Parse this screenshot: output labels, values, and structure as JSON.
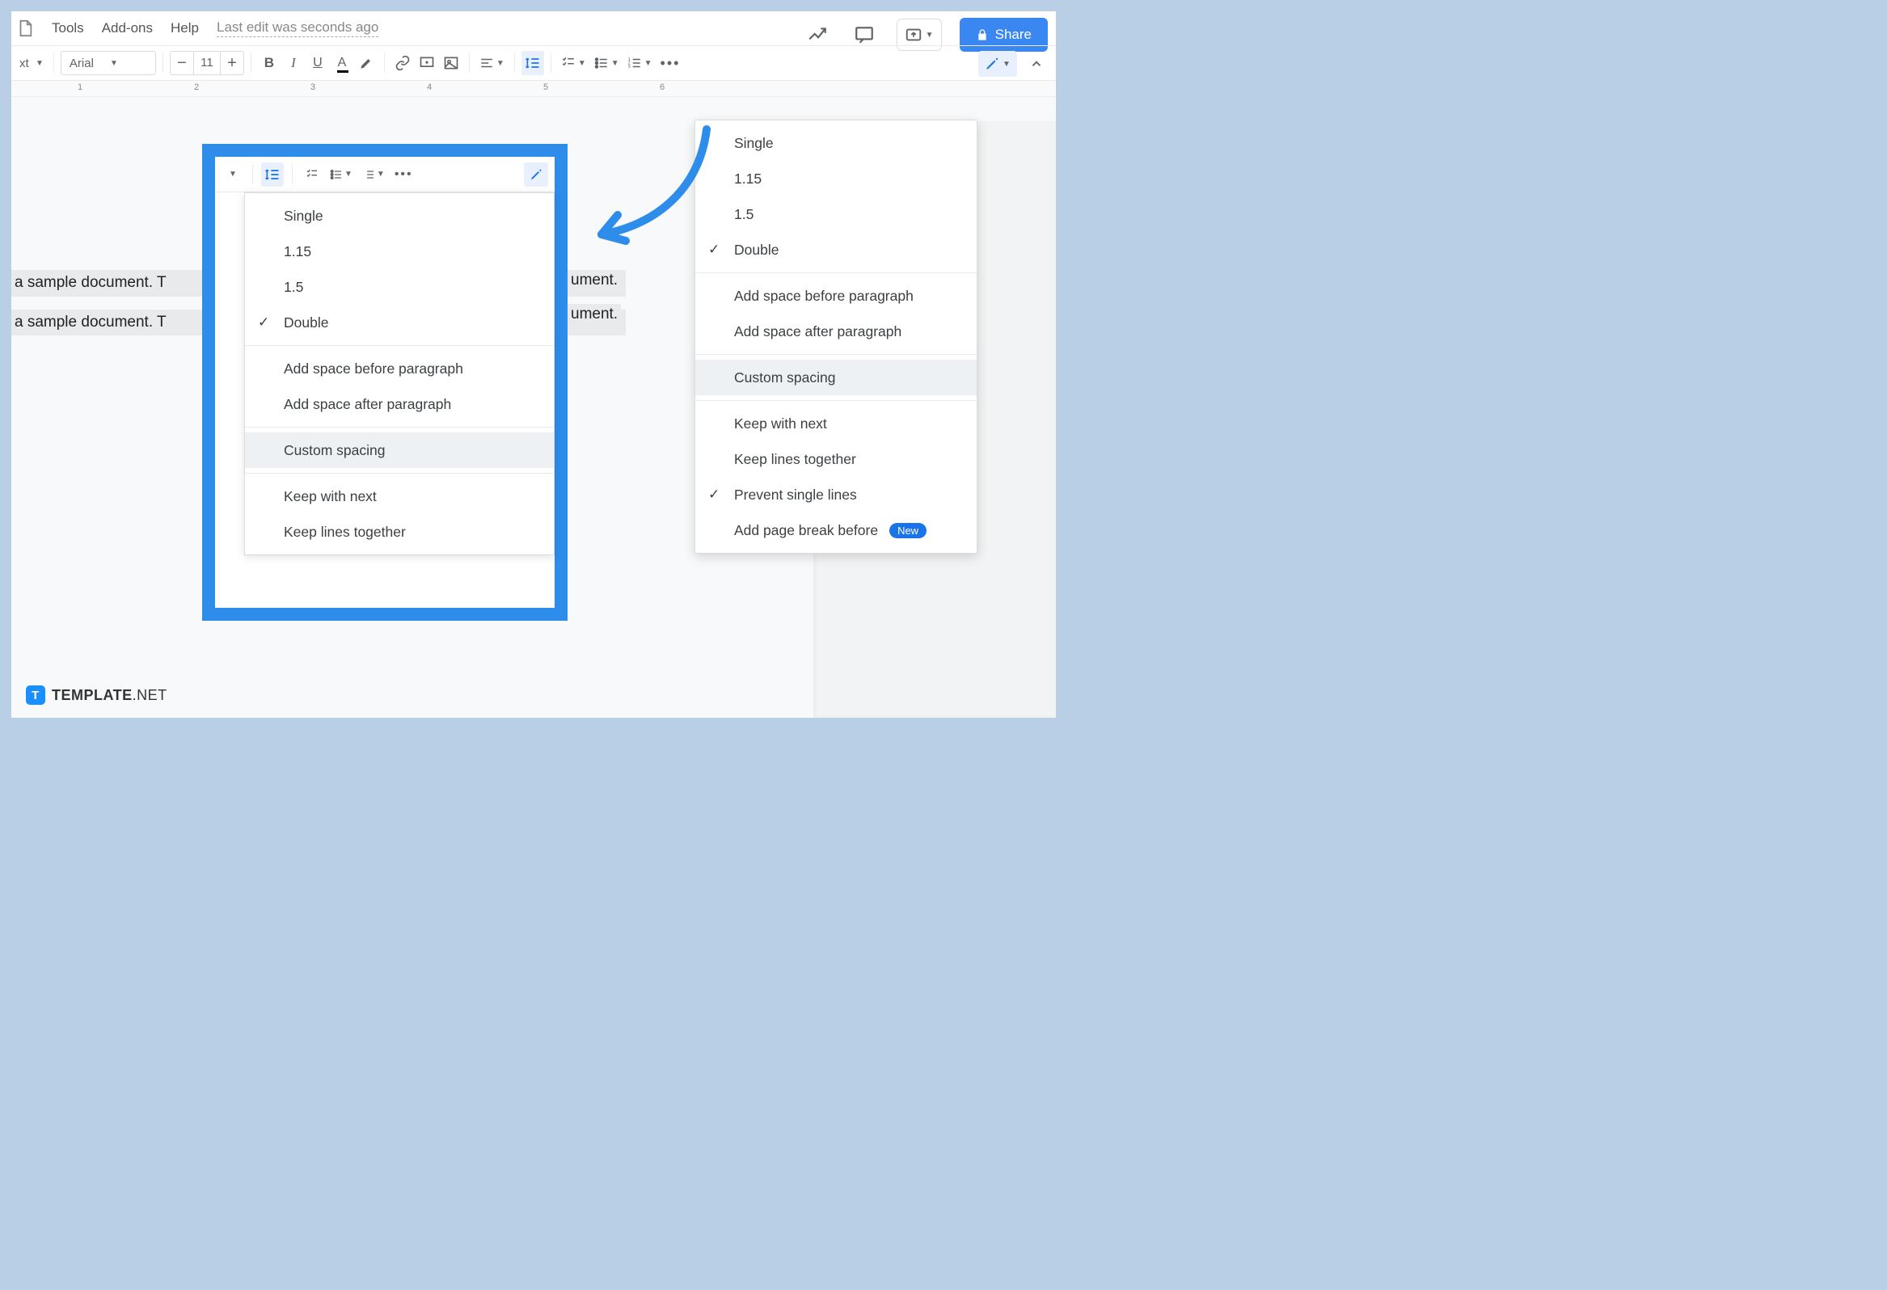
{
  "menu": {
    "tools": "Tools",
    "addons": "Add-ons",
    "help": "Help",
    "edit_status": "Last edit was seconds ago"
  },
  "share_label": "Share",
  "toolbar": {
    "style_label": "xt",
    "font": "Arial",
    "font_size": "11"
  },
  "doc": {
    "line1": "a sample document. T",
    "line2": "a sample document. T",
    "right1": "ument.",
    "right2": "ument."
  },
  "spacing_menu": {
    "single": "Single",
    "v115": "1.15",
    "v15": "1.5",
    "double": "Double",
    "before": "Add space before paragraph",
    "after": "Add space after paragraph",
    "custom": "Custom spacing",
    "keep_next": "Keep with next",
    "keep_lines": "Keep lines together",
    "prevent": "Prevent single lines",
    "page_break": "Add page break before",
    "new_badge": "New"
  },
  "ruler": [
    "1",
    "2",
    "3",
    "4",
    "5",
    "6"
  ],
  "footer": {
    "brand": "TEMPLATE",
    "suffix": ".NET",
    "icon": "T"
  }
}
